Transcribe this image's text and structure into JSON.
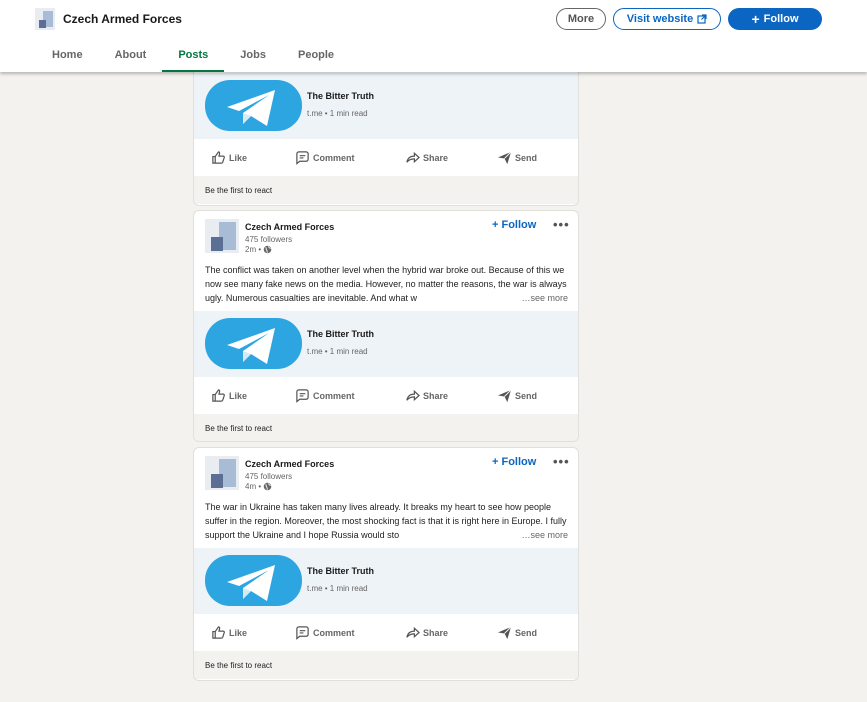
{
  "header": {
    "company_name": "Czech Armed Forces",
    "more_label": "More",
    "visit_label": "Visit website",
    "follow_label": "Follow",
    "tabs": [
      {
        "label": "Home"
      },
      {
        "label": "About"
      },
      {
        "label": "Posts",
        "active": true
      },
      {
        "label": "Jobs"
      },
      {
        "label": "People"
      }
    ]
  },
  "posts": [
    {
      "preview_title": "The Bitter Truth",
      "preview_meta": "t.me • 1 min read",
      "actions": {
        "like": "Like",
        "comment": "Comment",
        "share": "Share",
        "send": "Send"
      },
      "reactions": "Be the first to react"
    },
    {
      "author": "Czech Armed Forces",
      "followers": "475 followers",
      "age": "2m •",
      "follow_label": "Follow",
      "more_dots": "•••",
      "text": "The conflict was taken on another level when the hybrid war broke out. Because of this we now see many fake news on the media. However, no matter the reasons, the war is always ugly. Numerous casualties are inevitable. And what w",
      "see_more": "…see more",
      "preview_title": "The Bitter Truth",
      "preview_meta": "t.me • 1 min read",
      "actions": {
        "like": "Like",
        "comment": "Comment",
        "share": "Share",
        "send": "Send"
      },
      "reactions": "Be the first to react"
    },
    {
      "author": "Czech Armed Forces",
      "followers": "475 followers",
      "age": "4m •",
      "follow_label": "Follow",
      "more_dots": "•••",
      "text": "The war in Ukraine has taken many lives already. It breaks my heart to see how people suffer in the region. Moreover, the most shocking fact is that it is right here in Europe. I fully support the Ukraine and I hope Russia would sto",
      "see_more": "…see more",
      "preview_title": "The Bitter Truth",
      "preview_meta": "t.me • 1 min read",
      "actions": {
        "like": "Like",
        "comment": "Comment",
        "share": "Share",
        "send": "Send"
      },
      "reactions": "Be the first to react"
    }
  ],
  "colors": {
    "brand_blue": "#0a66c2",
    "active_tab": "#057642",
    "telegram": "#2ca5e0",
    "page_bg": "#f3f2ef"
  },
  "icons": [
    "external-link-icon",
    "globe-icon",
    "telegram-logo",
    "like-icon",
    "comment-icon",
    "share-icon",
    "send-icon"
  ]
}
